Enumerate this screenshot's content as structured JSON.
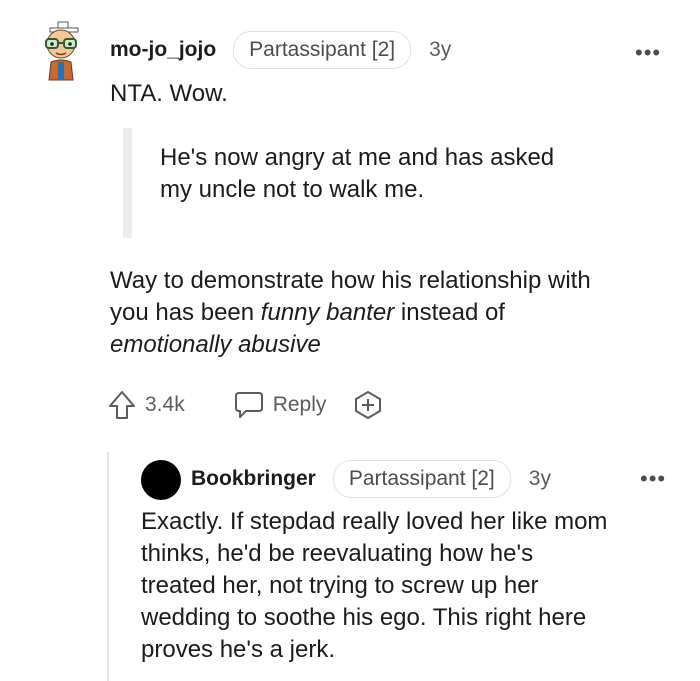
{
  "comment": {
    "username": "mo-jo_jojo",
    "flair": "Partassipant [2]",
    "age": "3y",
    "more": "•••",
    "line1": "NTA. Wow.",
    "quote": {
      "line1": "He's now angry at me and has asked",
      "line2": "my uncle not to walk me."
    },
    "para": {
      "line1": "Way to demonstrate how his relationship with",
      "line2_a": "you has been ",
      "line2_em": "funny banter",
      "line2_b": " instead of",
      "line3_em": "emotionally abusive"
    },
    "actions": {
      "upvote_icon": "arrow-up-icon",
      "votes": "3.4k",
      "reply_icon": "speech-bubble-icon",
      "reply_label": "Reply",
      "award_icon": "add-award-icon"
    }
  },
  "reply": {
    "username": "Bookbringer",
    "flair": "Partassipant [2]",
    "age": "3y",
    "more": "•••",
    "lines": [
      "Exactly. If stepdad really loved her like mom",
      "thinks, he'd be reevaluating how he's",
      "treated her, not trying to screw up her",
      "wedding to soothe his ego. This right here",
      "proves he's a jerk."
    ]
  }
}
